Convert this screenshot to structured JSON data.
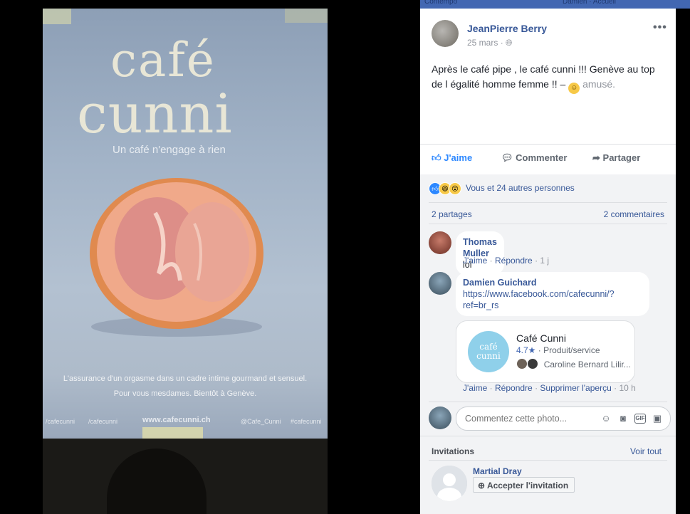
{
  "topbar": {
    "left_faint": "Contempo",
    "right_faint": "Damien · Accueil"
  },
  "poster": {
    "brand_line1": "café",
    "brand_line2": "cunni",
    "tagline": "Un café n'engage à rien",
    "body_line1": "L'assurance d'un orgasme dans un cadre intime gourmand et sensuel.",
    "body_line2": "Pour vous mesdames. Bientôt à Genève.",
    "footer_left": "/cafecunni",
    "footer_ig": "/cafecunni",
    "footer_site": "www.cafecunni.ch",
    "footer_twitter": "@Cafe_Cunni",
    "footer_right": "#cafecunni"
  },
  "post": {
    "author": "JeanPierre Berry",
    "date": "25 mars",
    "text_main": "Après le café pipe , le café cunni !!! Genève au top de l égalité homme femme !! –",
    "feeling": "amusé.",
    "more_label": "•••"
  },
  "actions": {
    "like": "J'aime",
    "comment": "Commenter",
    "share": "Partager"
  },
  "stats": {
    "reactions_text": "Vous et 24 autres personnes",
    "shares": "2 partages",
    "comments": "2 commentaires"
  },
  "comments": [
    {
      "author": "Thomas Muller",
      "text": "lol",
      "like": "J'aime",
      "reply": "Répondre",
      "time": "1 j"
    },
    {
      "author": "Damien Guichard",
      "text_line1": "https://www.facebook.com/cafecunni/?",
      "text_line2": "ref=br_rs",
      "like": "J'aime",
      "reply": "Répondre",
      "remove_preview": "Supprimer l'aperçu",
      "time": "10 h"
    }
  ],
  "link_card": {
    "logo_line1": "café",
    "logo_line2": "cunni",
    "title": "Café Cunni",
    "rating": "4.7★",
    "category": "Produit/service",
    "friends": "Caroline Bernard Lilir..."
  },
  "composer": {
    "placeholder": "Commentez cette photo..."
  },
  "invitations": {
    "title": "Invitations",
    "see_all": "Voir tout",
    "name": "Martial Dray",
    "accept": "Accepter l'invitation"
  },
  "colors": {
    "facebook_blue": "#4267b2",
    "link": "#385898",
    "like_active": "#2d88ff"
  }
}
